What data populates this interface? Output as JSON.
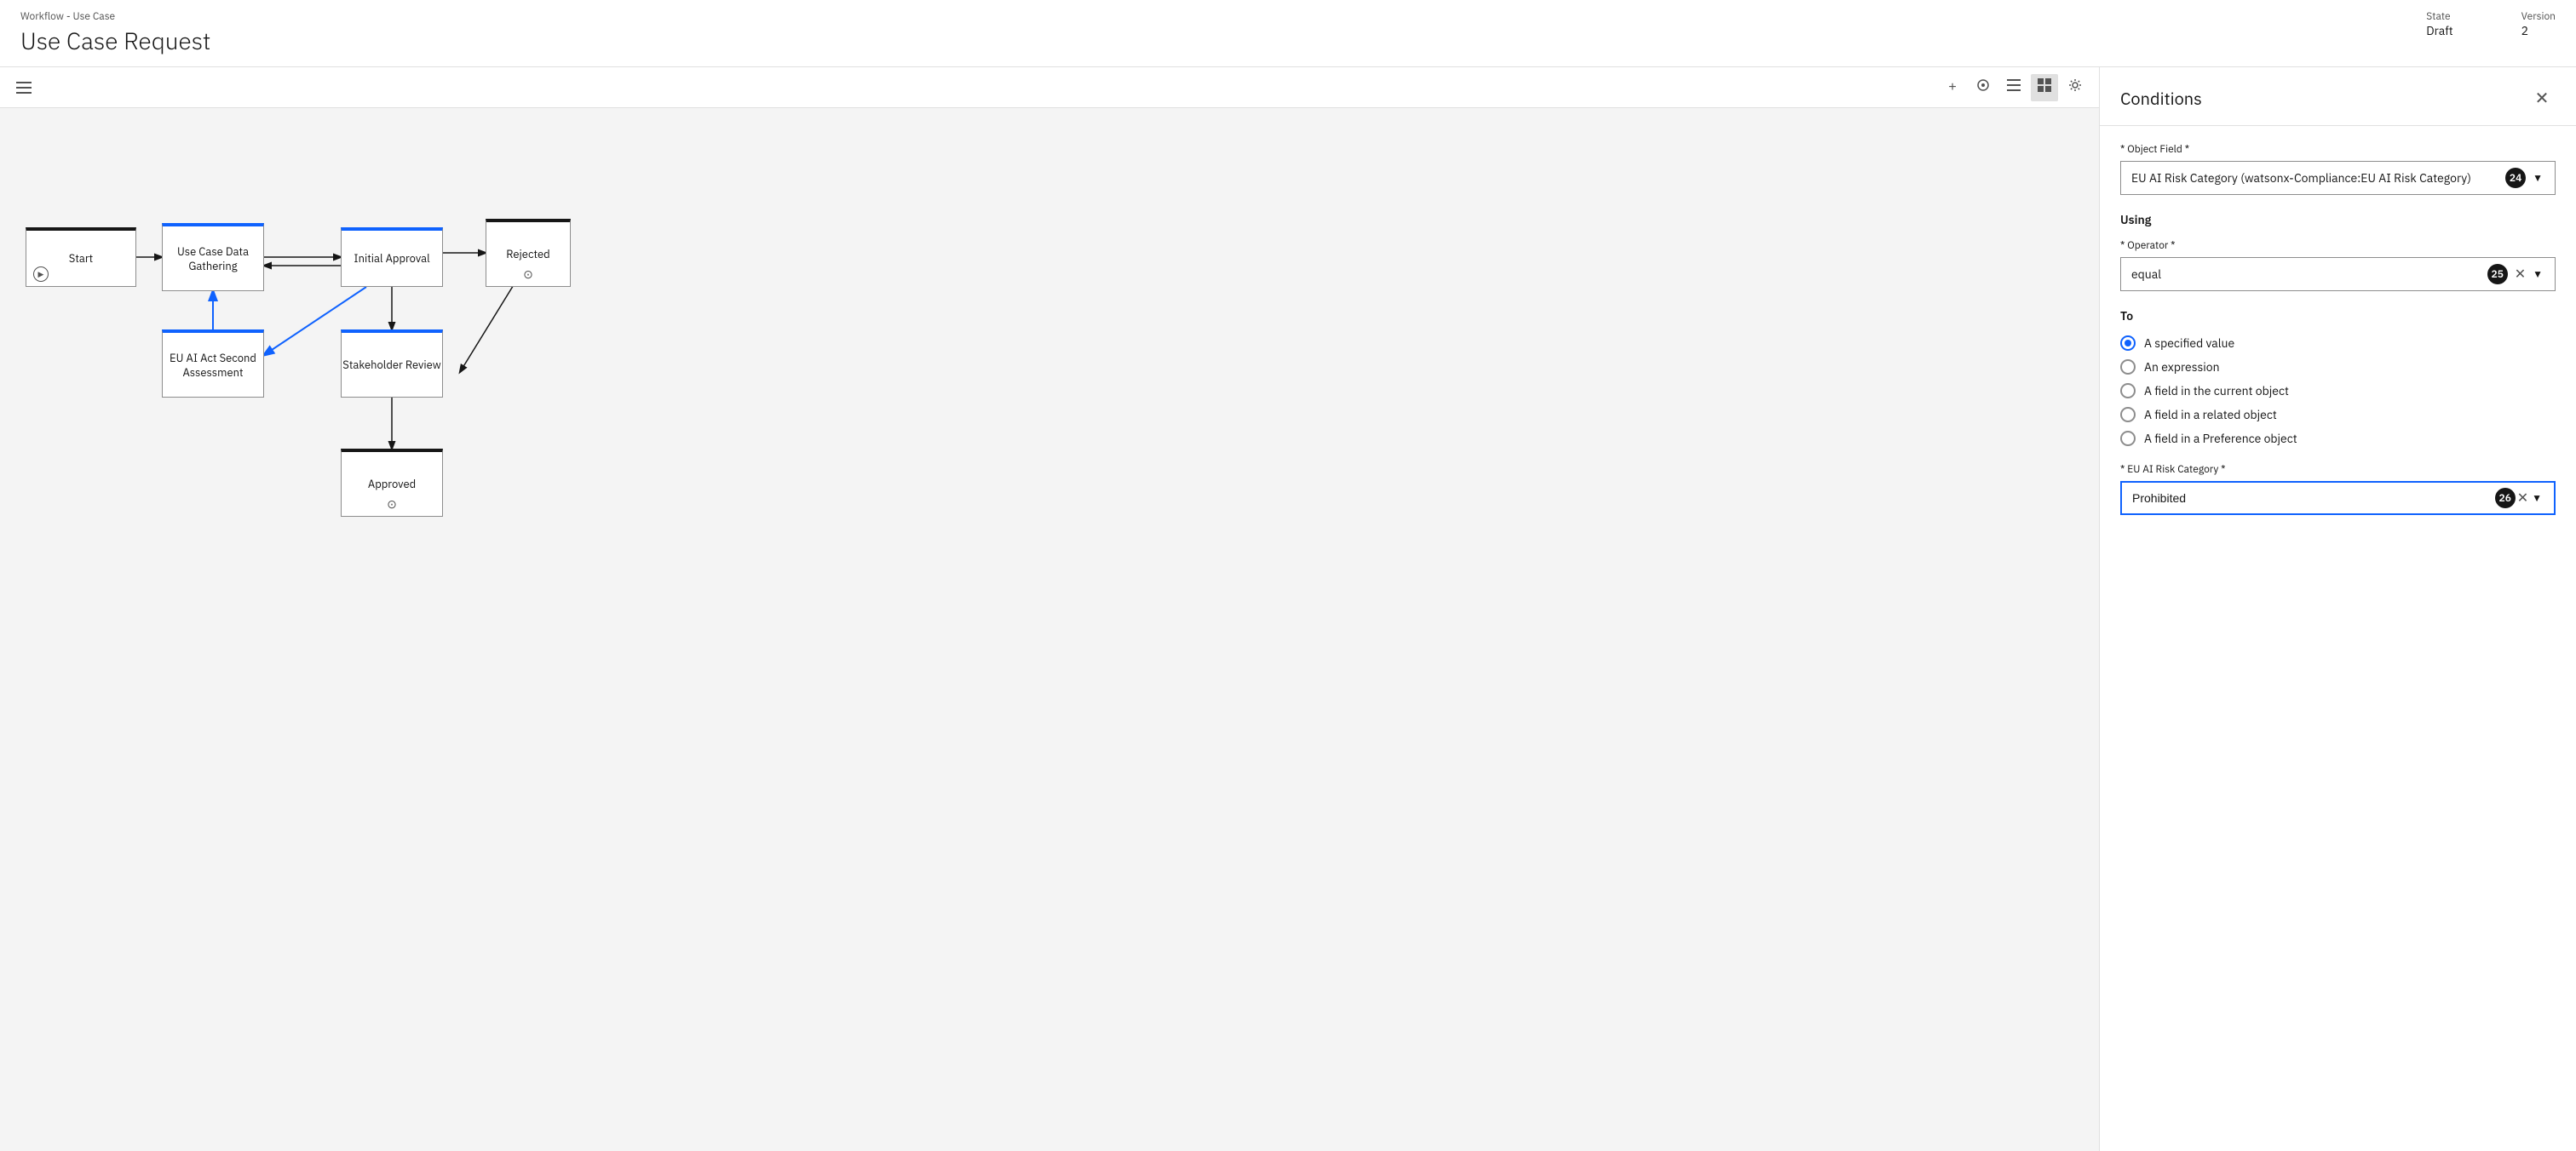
{
  "header": {
    "subtitle": "Workflow - Use Case",
    "title": "Use Case Request",
    "state_label": "State",
    "state_value": "Draft",
    "version_label": "Version",
    "version_value": "2"
  },
  "toolbar": {
    "sidebar_toggle": "☰",
    "add": "+",
    "connect": "⬡",
    "list": "≡",
    "grid": "⊞",
    "settings": "⚙"
  },
  "workflow": {
    "nodes": [
      {
        "id": "start",
        "label": "Start"
      },
      {
        "id": "gathering",
        "label": "Use Case Data Gathering"
      },
      {
        "id": "approval",
        "label": "Initial Approval"
      },
      {
        "id": "rejected",
        "label": "Rejected"
      },
      {
        "id": "eu-act",
        "label": "EU AI Act Second Assessment"
      },
      {
        "id": "stakeholder",
        "label": "Stakeholder Review"
      },
      {
        "id": "approved",
        "label": "Approved"
      }
    ]
  },
  "panel": {
    "title": "Conditions",
    "close_icon": "✕",
    "object_field_label": "* Object Field *",
    "object_field_value": "EU AI Risk Category (watsonx-Compliance:EU AI Risk Category)",
    "object_field_badge": "24",
    "using_label": "Using",
    "operator_label": "* Operator *",
    "operator_value": "equal",
    "operator_badge": "25",
    "to_label": "To",
    "to_options": [
      {
        "id": "specified",
        "label": "A specified value",
        "checked": true
      },
      {
        "id": "expression",
        "label": "An expression",
        "checked": false
      },
      {
        "id": "current",
        "label": "A field in the current object",
        "checked": false
      },
      {
        "id": "related",
        "label": "A field in a related object",
        "checked": false
      },
      {
        "id": "preference",
        "label": "A field in a Preference object",
        "checked": false
      }
    ],
    "eu_risk_label": "* EU AI Risk Category *",
    "eu_risk_value": "Prohibited",
    "eu_risk_badge": "26"
  }
}
